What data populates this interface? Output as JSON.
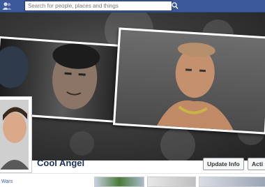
{
  "topbar": {
    "search_placeholder": "Search for people, places and things"
  },
  "profile": {
    "name": "Cool Angel"
  },
  "actions": {
    "update_info": "Update Info",
    "activity": "Acti"
  },
  "sidebar": {
    "partial_item": "Wars"
  },
  "colors": {
    "brand": "#3b5998",
    "name": "#1a2f5e"
  }
}
